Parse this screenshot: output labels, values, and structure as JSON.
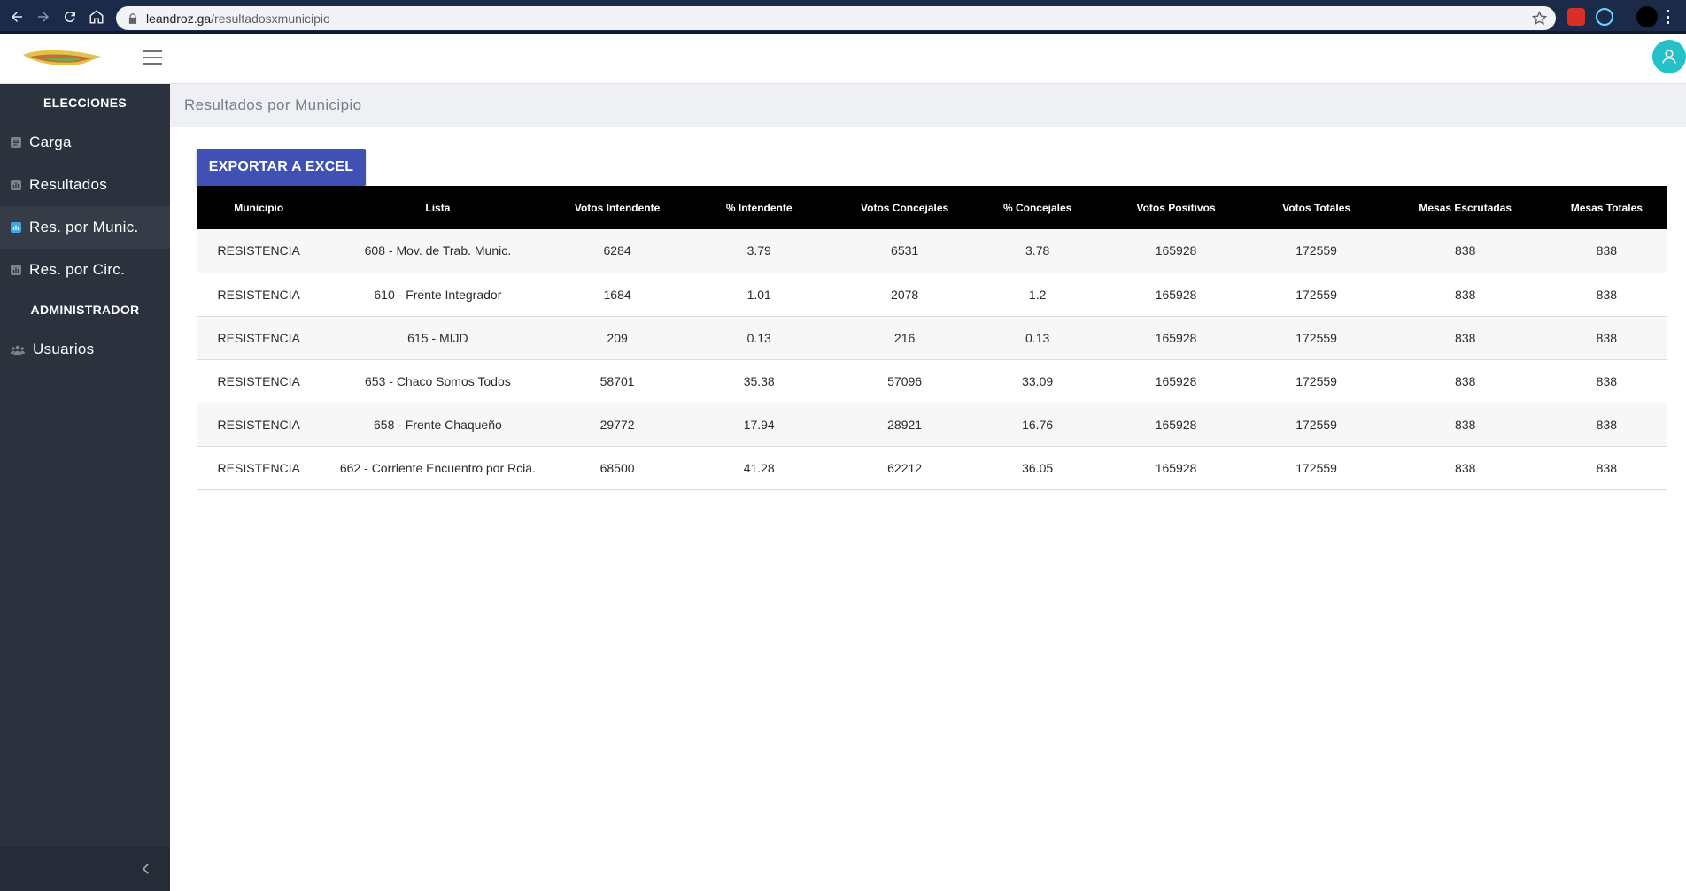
{
  "browser": {
    "url_host": "leandroz.ga",
    "url_path": "/resultadosxmunicipio"
  },
  "sidebar": {
    "section_elecciones": "ELECCIONES",
    "items": [
      {
        "label": "Carga",
        "icon": "file-icon"
      },
      {
        "label": "Resultados",
        "icon": "chart-icon"
      },
      {
        "label": "Res. por Munic.",
        "icon": "chart-icon",
        "active": true
      },
      {
        "label": "Res. por Circ.",
        "icon": "chart-icon"
      }
    ],
    "section_admin": "ADMINISTRADOR",
    "admin_items": [
      {
        "label": "Usuarios",
        "icon": "users-icon"
      }
    ]
  },
  "page": {
    "title": "Resultados por Municipio",
    "export_label": "EXPORTAR A EXCEL"
  },
  "table": {
    "headers": [
      "Municipio",
      "Lista",
      "Votos Intendente",
      "% Intendente",
      "Votos Concejales",
      "% Concejales",
      "Votos Positivos",
      "Votos Totales",
      "Mesas Escrutadas",
      "Mesas Totales"
    ],
    "rows": [
      [
        "RESISTENCIA",
        "608 - Mov. de Trab. Munic.",
        "6284",
        "3.79",
        "6531",
        "3.78",
        "165928",
        "172559",
        "838",
        "838"
      ],
      [
        "RESISTENCIA",
        "610 - Frente Integrador",
        "1684",
        "1.01",
        "2078",
        "1.2",
        "165928",
        "172559",
        "838",
        "838"
      ],
      [
        "RESISTENCIA",
        "615 - MIJD",
        "209",
        "0.13",
        "216",
        "0.13",
        "165928",
        "172559",
        "838",
        "838"
      ],
      [
        "RESISTENCIA",
        "653 - Chaco Somos Todos",
        "58701",
        "35.38",
        "57096",
        "33.09",
        "165928",
        "172559",
        "838",
        "838"
      ],
      [
        "RESISTENCIA",
        "658 - Frente Chaqueño",
        "29772",
        "17.94",
        "28921",
        "16.76",
        "165928",
        "172559",
        "838",
        "838"
      ],
      [
        "RESISTENCIA",
        "662 - Corriente Encuentro por Rcia.",
        "68500",
        "41.28",
        "62212",
        "36.05",
        "165928",
        "172559",
        "838",
        "838"
      ]
    ]
  },
  "colors": {
    "sidebar_bg": "#2b323e",
    "accent_button": "#3f51b5",
    "active_icon": "#3fa4e6",
    "avatar": "#26c0c9"
  }
}
